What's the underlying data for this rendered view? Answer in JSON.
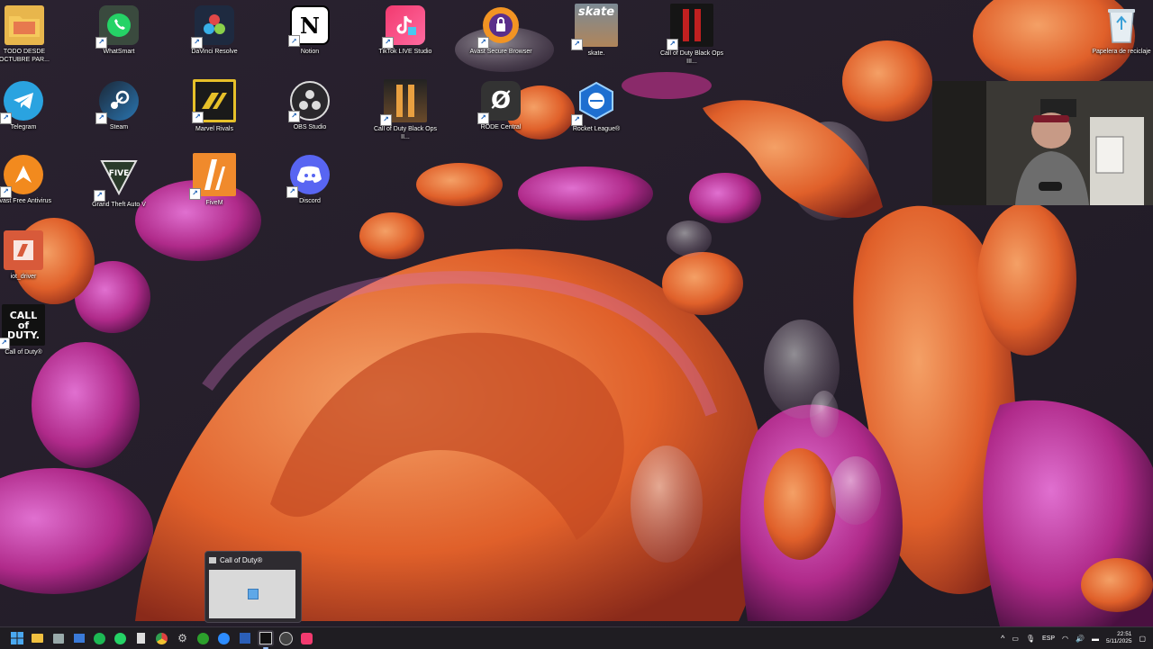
{
  "desktop": {
    "icons": [
      {
        "label": "TODO DESDE OCTUBRE PAR...",
        "icon": "folder-icon",
        "color": "#e8b64c"
      },
      {
        "label": "WhatSmart",
        "icon": "whatsapp-icon",
        "color": "#25d366"
      },
      {
        "label": "DaVinci Resolve",
        "icon": "davinci-resolve-icon",
        "color": "#2a3a55"
      },
      {
        "label": "Notion",
        "icon": "notion-icon",
        "color": "#ffffff"
      },
      {
        "label": "TikTok LIVE Studio",
        "icon": "tiktok-icon",
        "color": "#f23a6f"
      },
      {
        "label": "Avast Secure Browser",
        "icon": "avast-browser-icon",
        "color": "#f29423"
      },
      {
        "label": "skate.",
        "icon": "skate-icon",
        "color": "#7a6a50"
      },
      {
        "label": "Call of Duty Black Ops III...",
        "icon": "black-ops-icon",
        "color": "#8b1a1a"
      },
      {
        "label": "Telegram",
        "icon": "telegram-icon",
        "color": "#2aa3e0"
      },
      {
        "label": "Steam",
        "icon": "steam-icon",
        "color": "#1b2838"
      },
      {
        "label": "Marvel Rivals",
        "icon": "marvel-rivals-icon",
        "color": "#e6c029"
      },
      {
        "label": "OBS Studio",
        "icon": "obs-icon",
        "color": "#302e31"
      },
      {
        "label": "Call of Duty Black Ops II...",
        "icon": "black-ops-2-icon",
        "color": "#3a2a1a"
      },
      {
        "label": "RODE Central",
        "icon": "rode-icon",
        "color": "#333333"
      },
      {
        "label": "Rocket League®",
        "icon": "rocket-league-icon",
        "color": "#1e6fd0"
      },
      {
        "label": "Avast Free Antivirus",
        "icon": "avast-antivirus-icon",
        "color": "#f28a1e"
      },
      {
        "label": "Grand Theft Auto V",
        "icon": "gta-icon",
        "color": "#2b3b2b"
      },
      {
        "label": "FiveM",
        "icon": "fivem-icon",
        "color": "#f08a2c"
      },
      {
        "label": "Discord",
        "icon": "discord-icon",
        "color": "#5865f2"
      },
      {
        "label": "iot_driver",
        "icon": "driver-icon",
        "color": "#d85a3a"
      },
      {
        "label": "Call of Duty®",
        "icon": "call-of-duty-icon",
        "color": "#111111"
      },
      {
        "label": "Papelera de reciclaje",
        "icon": "recycle-bin-icon",
        "color": "#dfe8ee"
      }
    ]
  },
  "preview": {
    "title": "Call of Duty®"
  },
  "tray": {
    "language": "ESP",
    "time": "22:51",
    "date": "5/11/2025"
  }
}
